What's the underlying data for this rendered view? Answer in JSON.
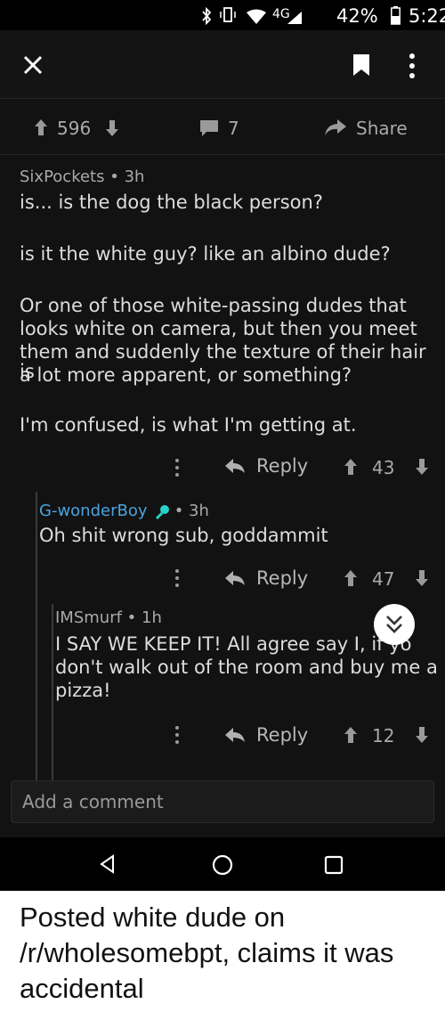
{
  "status_bar": {
    "network": "4G",
    "battery": "42%",
    "time": "5:22"
  },
  "post_actions": {
    "votes": "596",
    "comments": "7",
    "share_label": "Share"
  },
  "comments": [
    {
      "author": "SixPockets",
      "age": "3h",
      "paragraphs": [
        "is... is the dog the black person?",
        "is it the white guy? like an albino dude?",
        "Or one of those white-passing dudes that",
        "looks white on camera, but then you meet",
        "them and suddenly the texture of their hair is",
        "a lot more apparent, or something?",
        "I'm confused, is what I'm getting at."
      ],
      "reply_label": "Reply",
      "votes": "43"
    },
    {
      "author": "G-wonderBoy",
      "age": "3h",
      "paragraphs": [
        "Oh shit wrong sub, goddammit"
      ],
      "reply_label": "Reply",
      "votes": "47"
    },
    {
      "author": "IMSmurf",
      "age": "1h",
      "paragraphs": [
        "I SAY WE KEEP IT! All agree say I, if yo",
        "don't walk out of the room and buy me a",
        "pizza!"
      ],
      "reply_label": "Reply",
      "votes": "12"
    }
  ],
  "add_comment_placeholder": "Add a comment",
  "caption": {
    "lines": [
      "Posted white dude on",
      "/r/wholesomebpt, claims it was",
      "accidental"
    ]
  },
  "colors": {
    "username_highlight": "#4aa3df",
    "background": "#121212",
    "mic_icon": "#29d1c6"
  }
}
